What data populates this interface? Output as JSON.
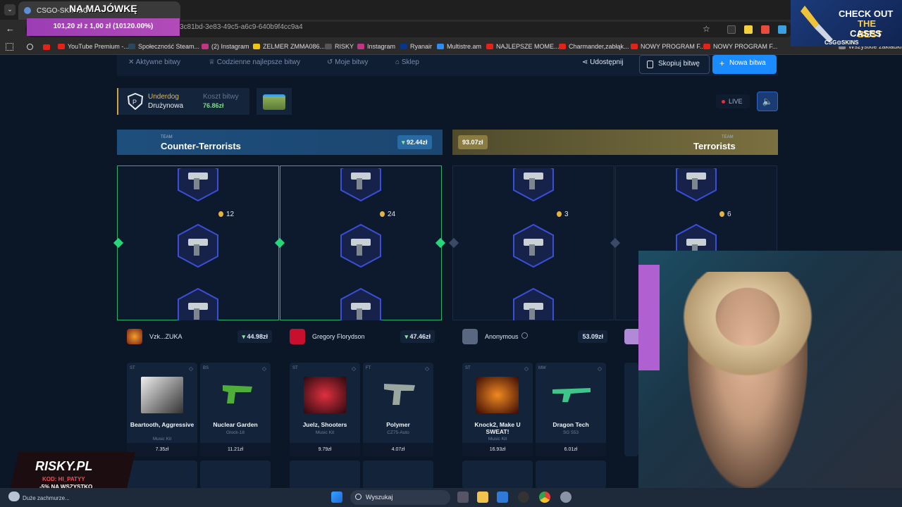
{
  "browser": {
    "tab_title": "CSGO-SKINS.C",
    "url": "3c81bd-3e83-49c5-a6c9-640b9f4cc9a4",
    "bookmarks": [
      "YouTube Premium -...",
      "Społeczność Steam...",
      "(2) Instagram",
      "ZELMER ZMMA086...",
      "RISKY",
      "Instagram",
      "Ryanair",
      "Multistre.am",
      "NAJLEPSZE MOME...",
      "Charmander,zabłąk...",
      "NOWY PROGRAM F...",
      "NOWY PROGRAM F...",
      "Wszystkie zakładki"
    ]
  },
  "overlay": {
    "top_text": "NA MAJÓWKĘ",
    "donation": "101,20 zł z 1,00 zł (10120.00%)",
    "promo_l1": "CHECK OUT",
    "promo_l2": "THE BEST",
    "promo_l3": "CASES",
    "promo_brand": "CSG⊙SKINS",
    "risky_logo": "RISKY.PL",
    "risky_code": "KOD: HI_PATYY",
    "risky_discount": "-5% NA WSZYSTKO"
  },
  "nav": {
    "active_battles": "Aktywne bitwy",
    "daily_best": "Codzienne najlepsze bitwy",
    "my_battles": "Moje bitwy",
    "shop": "Sklep",
    "share": "Udostępnij",
    "copy": "Skopiuj bitwę",
    "new": "Nowa bitwa"
  },
  "battle": {
    "mode_top": "Underdog",
    "mode_bottom": "Drużynowa",
    "cost_label": "Koszt bitwy",
    "cost_value": "76.86zł",
    "live": "LIVE"
  },
  "teams": {
    "ct": {
      "small": "TEAM",
      "name": "Counter-Terrorists",
      "total": "92.44zł"
    },
    "t": {
      "small": "TEAM",
      "name": "Terrorists",
      "total": "93.07zł"
    }
  },
  "reels": [
    {
      "coins": "12"
    },
    {
      "coins": "24"
    },
    {
      "coins": "3"
    },
    {
      "coins": "6"
    }
  ],
  "players": [
    {
      "name": "Vzk...ZUKA",
      "total": "44.98zł"
    },
    {
      "name": "Gregory Florydson",
      "total": "47.46zł"
    },
    {
      "name": "Anonymous",
      "total": "53.09zł"
    }
  ],
  "items": [
    {
      "cond": "ST",
      "name": "Beartooth, Aggressive",
      "type": "Music Kit",
      "price": "7.35zł"
    },
    {
      "cond": "BS",
      "name": "Nuclear Garden",
      "type": "Glock-18",
      "price": "11.21zł"
    },
    {
      "cond": "ST",
      "name": "Juelz, Shooters",
      "type": "Music Kit",
      "price": "9.79zł"
    },
    {
      "cond": "FT",
      "name": "Polymer",
      "type": "CZ75-Auto",
      "price": "4.07zł"
    },
    {
      "cond": "ST",
      "name": "Knock2, Make U SWEAT!",
      "type": "Music Kit",
      "price": "16.93zł"
    },
    {
      "cond": "MW",
      "name": "Dragon Tech",
      "type": "SG 553",
      "price": "6.01zł"
    }
  ],
  "taskbar": {
    "weather": "Duże zachmurze...",
    "search": "Wyszukaj"
  },
  "colors": {
    "ct_accent": "#27b36a",
    "new_button": "#1a8cff",
    "cost_green": "#7ddf8c",
    "underdog_gold": "#e6b84a"
  }
}
